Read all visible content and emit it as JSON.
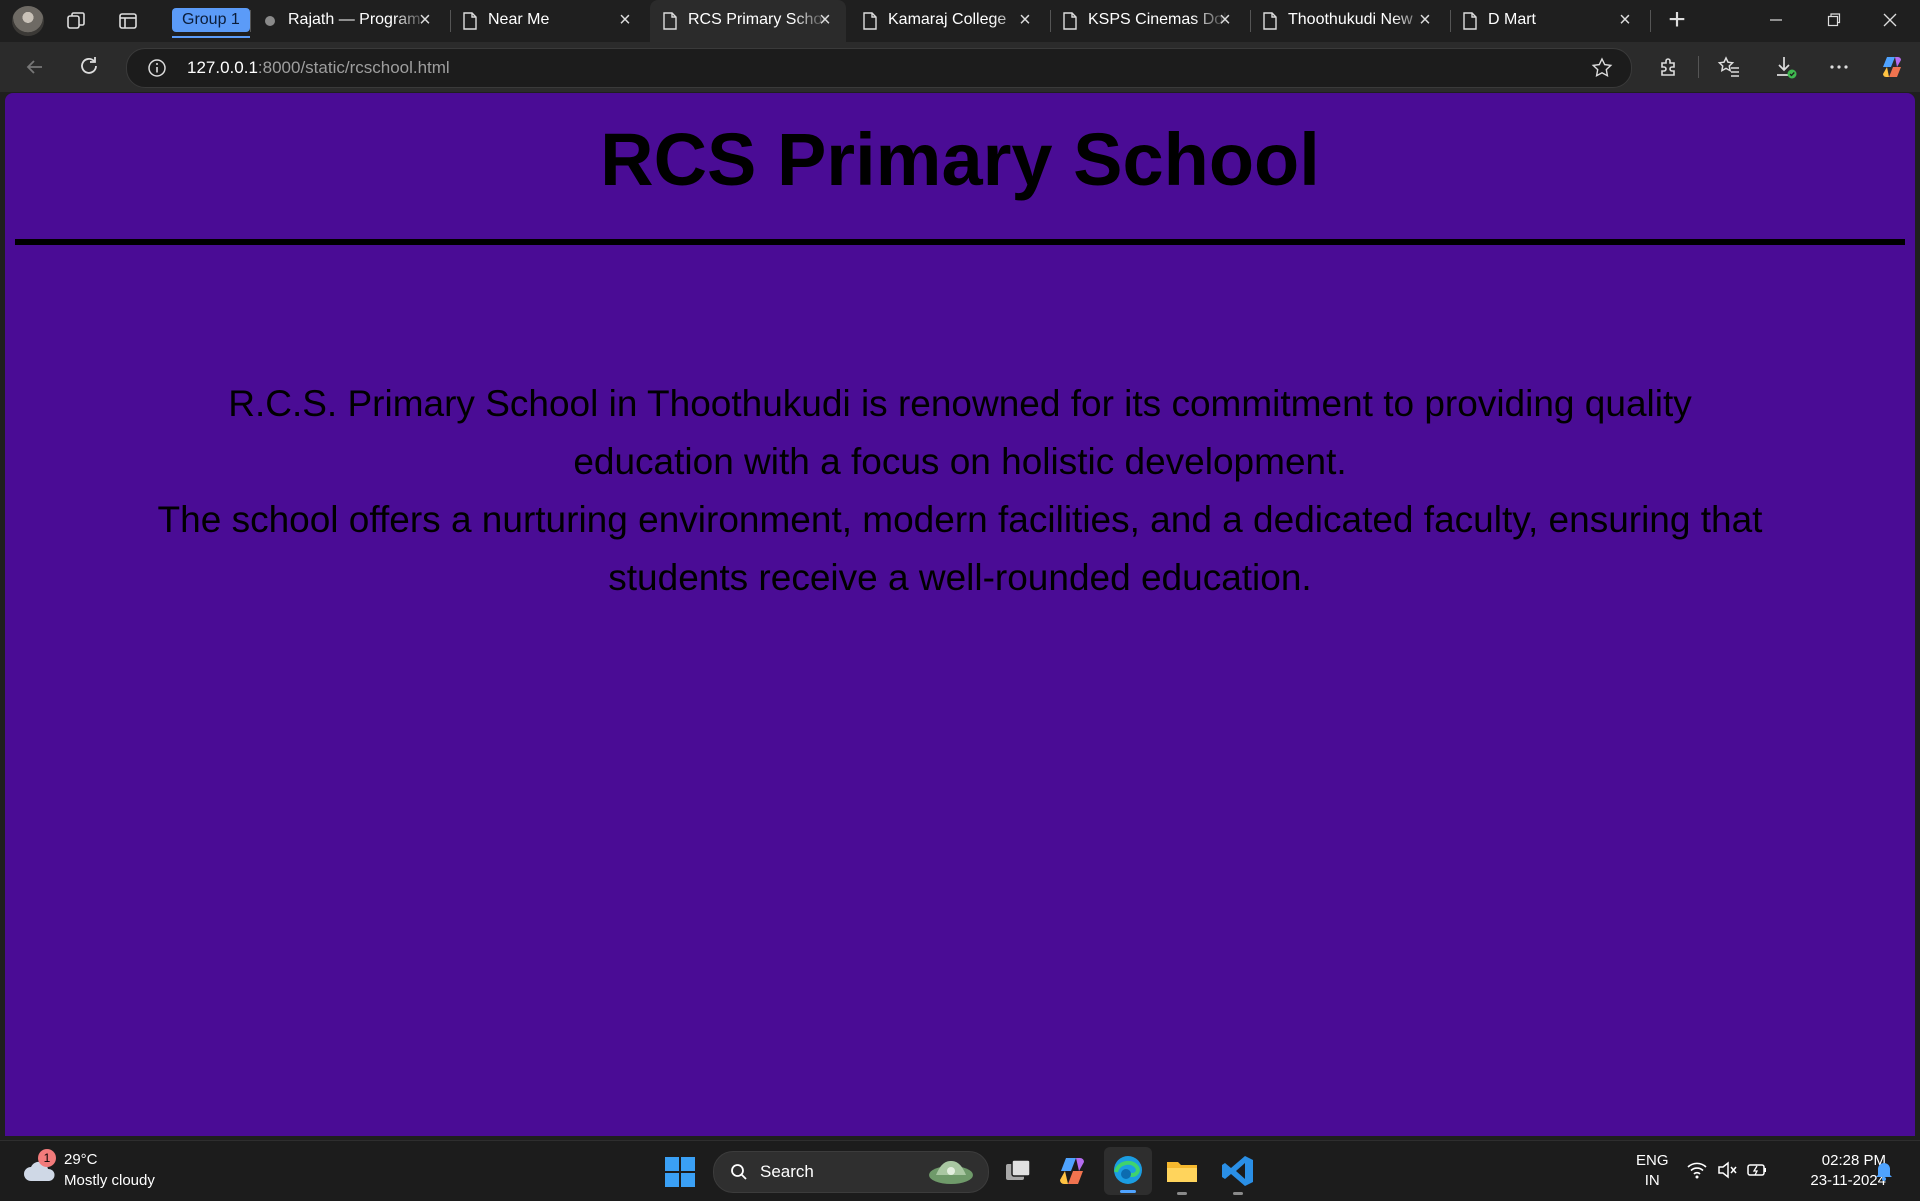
{
  "browser": {
    "group_label": "Group 1",
    "tabs": [
      {
        "title": "Rajath — Program",
        "favicon": "dot-icon",
        "active": false
      },
      {
        "title": "Near Me",
        "favicon": "page-icon",
        "active": false
      },
      {
        "title": "RCS Primary School",
        "favicon": "page-icon",
        "active": true
      },
      {
        "title": "Kamaraj College",
        "favicon": "page-icon",
        "active": false
      },
      {
        "title": "KSPS Cinemas Doll",
        "favicon": "page-icon",
        "active": false
      },
      {
        "title": "Thoothukudi New",
        "favicon": "page-icon",
        "active": false
      },
      {
        "title": "D Mart",
        "favicon": "page-icon",
        "active": false
      }
    ],
    "url": {
      "host": "127.0.0.1",
      "rest": ":8000/static/rcschool.html"
    }
  },
  "page": {
    "title": "RCS Primary School",
    "paragraph_line1": "R.C.S. Primary School in Thoothukudi is renowned for its commitment to providing quality education with a focus on holistic development.",
    "paragraph_line2": "The school offers a nurturing environment, modern facilities, and a dedicated faculty, ensuring that students receive a well-rounded education.",
    "background_color": "#4a0c95"
  },
  "taskbar": {
    "weather": {
      "badge": "1",
      "temp": "29°C",
      "condition": "Mostly cloudy"
    },
    "search_label": "Search",
    "lang": {
      "line1": "ENG",
      "line2": "IN"
    },
    "clock": {
      "time": "02:28 PM",
      "date": "23-11-2024"
    }
  }
}
